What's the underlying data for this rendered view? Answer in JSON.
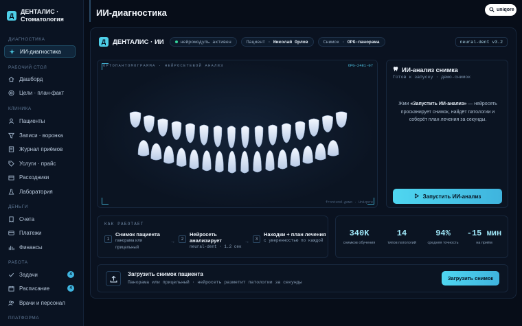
{
  "brand": {
    "logo_letter": "Д",
    "name": "ДЕНТАЛИС · Стоматология"
  },
  "sidebar": {
    "sections": [
      {
        "label": "Диагностика"
      },
      {
        "label": "Рабочий стол"
      },
      {
        "label": "Клиника"
      },
      {
        "label": "Деньги"
      },
      {
        "label": "Работа"
      },
      {
        "label": "Платформа"
      }
    ],
    "items": [
      {
        "label": "ИИ-диагностика",
        "icon": "sparkle-icon"
      },
      {
        "label": "Дашборд",
        "icon": "home-icon"
      },
      {
        "label": "Цели · план-факт",
        "icon": "target-icon"
      },
      {
        "label": "Пациенты",
        "icon": "user-icon"
      },
      {
        "label": "Записи · воронка",
        "icon": "funnel-icon"
      },
      {
        "label": "Журнал приёмов",
        "icon": "journal-icon"
      },
      {
        "label": "Услуги · прайс",
        "icon": "tag-icon"
      },
      {
        "label": "Расходники",
        "icon": "box-icon"
      },
      {
        "label": "Лаборатория",
        "icon": "flask-icon"
      },
      {
        "label": "Счета",
        "icon": "invoice-icon"
      },
      {
        "label": "Платежи",
        "icon": "card-icon"
      },
      {
        "label": "Финансы",
        "icon": "chart-icon"
      },
      {
        "label": "Задачи",
        "icon": "check-icon",
        "badge": "4"
      },
      {
        "label": "Расписание",
        "icon": "calendar-icon",
        "badge": "4"
      },
      {
        "label": "Врачи и персонал",
        "icon": "team-icon"
      }
    ]
  },
  "header": {
    "title": "ИИ-диагностика",
    "user": "uniqore"
  },
  "topbar": {
    "logo_letter": "Д",
    "title": "ДЕНТАЛИС · ИИ",
    "status": "нейромодуль активен",
    "patient_label": "Пациент ·",
    "patient_name": "Николай Орлов",
    "image_label": "Снимок ·",
    "image_name": "OPG-панорама",
    "version": "neural-dent v3.2"
  },
  "xray": {
    "label": "ОРТОПАНТОМОГРАММА · НЕЙРОСЕТЕВОЙ АНАЛИЗ",
    "id": "OPG-2481-07",
    "footer": "frontend-демо · Uniqore"
  },
  "ai_panel": {
    "title": "ИИ-анализ снимка",
    "title_icon": "tooth-icon",
    "subtitle": "Готов к запуску · демо-снимок",
    "desc_prefix": "Жми ",
    "desc_bold": "«Запустить ИИ-анализ»",
    "desc_suffix": " — нейросеть просканирует снимок, найдёт патологии и соберёт план лечения за секунды.",
    "run_button": "Запустить ИИ-анализ"
  },
  "how": {
    "title": "КАК РАБОТАЕТ",
    "steps": [
      {
        "num": "1",
        "title": "Снимок пациента",
        "sub": "панорама или прицельный"
      },
      {
        "num": "2",
        "title": "Нейросеть анализирует",
        "sub": "neural-dent · 1.2 сек"
      },
      {
        "num": "3",
        "title": "Находки + план лечения",
        "sub": "с уверенностью по каждой"
      }
    ]
  },
  "stats": [
    {
      "value": "340K",
      "label": "снимков обучения"
    },
    {
      "value": "14",
      "label": "типов патологий"
    },
    {
      "value": "94%",
      "label": "средняя точность"
    },
    {
      "value": "-15 мин",
      "label": "на приём"
    }
  ],
  "upload": {
    "title": "Загрузить снимок пациента",
    "subtitle": "Панорама или прицельный · нейросеть разметит патологии за секунды",
    "button": "Загрузить снимок"
  },
  "colors": {
    "accent": "#4fd6f0",
    "background": "#070d18",
    "panel": "#0b1422",
    "status": "#34d39a"
  }
}
